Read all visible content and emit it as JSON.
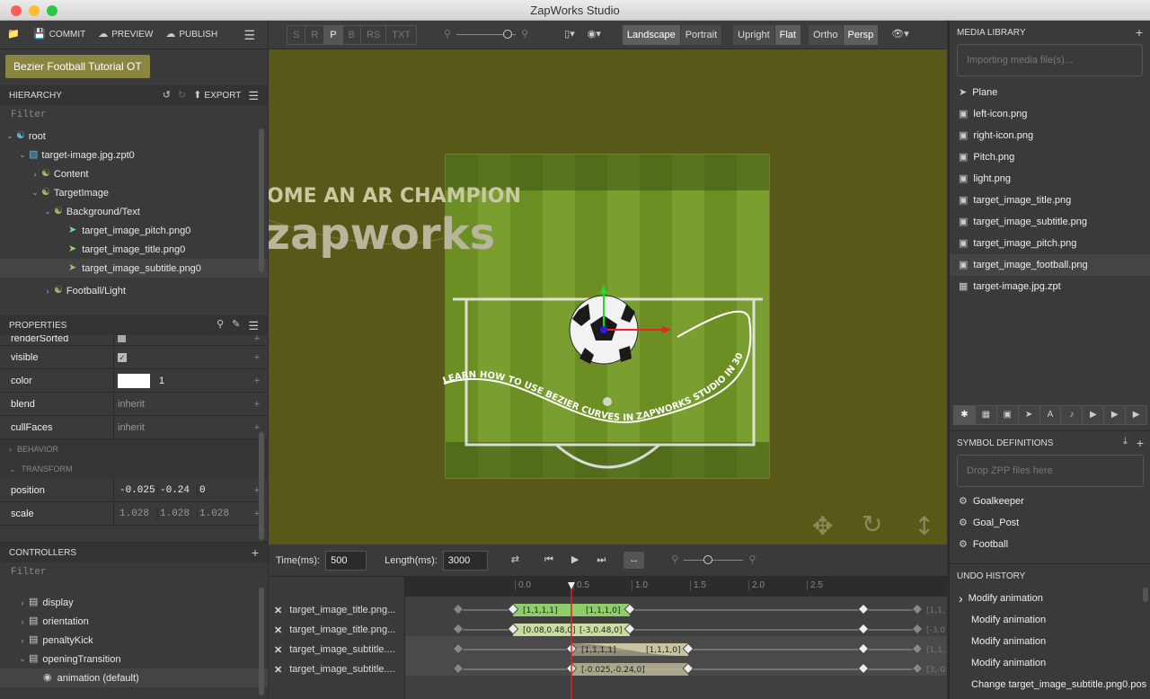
{
  "window": {
    "title": "ZapWorks Studio"
  },
  "toolbar": {
    "commit": "COMMIT",
    "preview": "PREVIEW",
    "publish": "PUBLISH"
  },
  "project": {
    "name": "Bezier Football Tutorial OT"
  },
  "hierarchy": {
    "title": "HIERARCHY",
    "export": "EXPORT",
    "filter": "Filter",
    "items": [
      {
        "label": "root"
      },
      {
        "label": "target-image.jpg.zpt0"
      },
      {
        "label": "Content"
      },
      {
        "label": "TargetImage"
      },
      {
        "label": "Background/Text"
      },
      {
        "label": "target_image_pitch.png0"
      },
      {
        "label": "target_image_title.png0"
      },
      {
        "label": "target_image_subtitle.png0"
      },
      {
        "label": "Football/Light"
      }
    ]
  },
  "properties": {
    "title": "PROPERTIES",
    "rows": [
      {
        "key": "renderSorted"
      },
      {
        "key": "visible"
      },
      {
        "key": "color",
        "value": "1"
      },
      {
        "key": "blend",
        "value": "inherit"
      },
      {
        "key": "cullFaces",
        "value": "inherit"
      }
    ],
    "behavior": "BEHAVIOR",
    "transform": "TRANSFORM",
    "position": {
      "key": "position",
      "x": "-0.025",
      "y": "-0.24",
      "z": "0"
    },
    "scale": {
      "key": "scale",
      "x": "1.028",
      "y": "1.028",
      "z": "1.028"
    }
  },
  "controllers": {
    "title": "CONTROLLERS",
    "filter": "Filter",
    "items": [
      {
        "label": "display"
      },
      {
        "label": "orientation"
      },
      {
        "label": "penaltyKick"
      },
      {
        "label": "openingTransition"
      },
      {
        "label": "animation (default)"
      }
    ]
  },
  "viewbar": {
    "modes": [
      "S",
      "R",
      "P",
      "B",
      "RS",
      "TXT"
    ],
    "orientation": [
      "Landscape",
      "Portrait"
    ],
    "tracking": [
      "Upright",
      "Flat"
    ],
    "projection": [
      "Ortho",
      "Persp"
    ]
  },
  "scene": {
    "banner": "OME AN AR CHAMPION",
    "logo": "zapworks",
    "curve_text": "LEARN HOW TO USE BEZIER CURVES IN ZAPWORKS STUDIO IN 30 MINS"
  },
  "timeline": {
    "time_label": "Time(ms):",
    "time_value": "500",
    "length_label": "Length(ms):",
    "length_value": "3000",
    "ticks": [
      "0.0",
      "0.5",
      "1.0",
      "1.5",
      "2.0",
      "2.5"
    ],
    "tracks": [
      {
        "name": "target_image_title.png...",
        "left": "[1,1,1,1]",
        "right": "[1,1,1,0]",
        "end": "[1,1,"
      },
      {
        "name": "target_image_title.png...",
        "left": "[0.08,0.48,0]",
        "right": "[-3,0.48,0]",
        "end": "[-3,0"
      },
      {
        "name": "target_image_subtitle....",
        "left": "[1,1,1,1]",
        "right": "[1,1,1,0]",
        "end": "[1,1,"
      },
      {
        "name": "target_image_subtitle....",
        "left": "[-0.025,-0.24,0]",
        "right": "",
        "end": "[3,-0"
      }
    ]
  },
  "media": {
    "title": "MEDIA LIBRARY",
    "importing": "Importing media file(s)...",
    "items": [
      {
        "label": "Plane"
      },
      {
        "label": "left-icon.png"
      },
      {
        "label": "right-icon.png"
      },
      {
        "label": "Pitch.png"
      },
      {
        "label": "light.png"
      },
      {
        "label": "target_image_title.png"
      },
      {
        "label": "target_image_subtitle.png"
      },
      {
        "label": "target_image_pitch.png"
      },
      {
        "label": "target_image_football.png"
      },
      {
        "label": "target-image.jpg.zpt"
      }
    ]
  },
  "symbols": {
    "title": "SYMBOL DEFINITIONS",
    "drop": "Drop ZPP files here",
    "items": [
      {
        "label": "Goalkeeper"
      },
      {
        "label": "Goal_Post"
      },
      {
        "label": "Football"
      }
    ]
  },
  "undo": {
    "title": "UNDO HISTORY",
    "items": [
      {
        "label": "Modify animation"
      },
      {
        "label": "Modify animation"
      },
      {
        "label": "Modify animation"
      },
      {
        "label": "Modify animation"
      },
      {
        "label": "Change target_image_subtitle.png0.pos"
      }
    ]
  }
}
